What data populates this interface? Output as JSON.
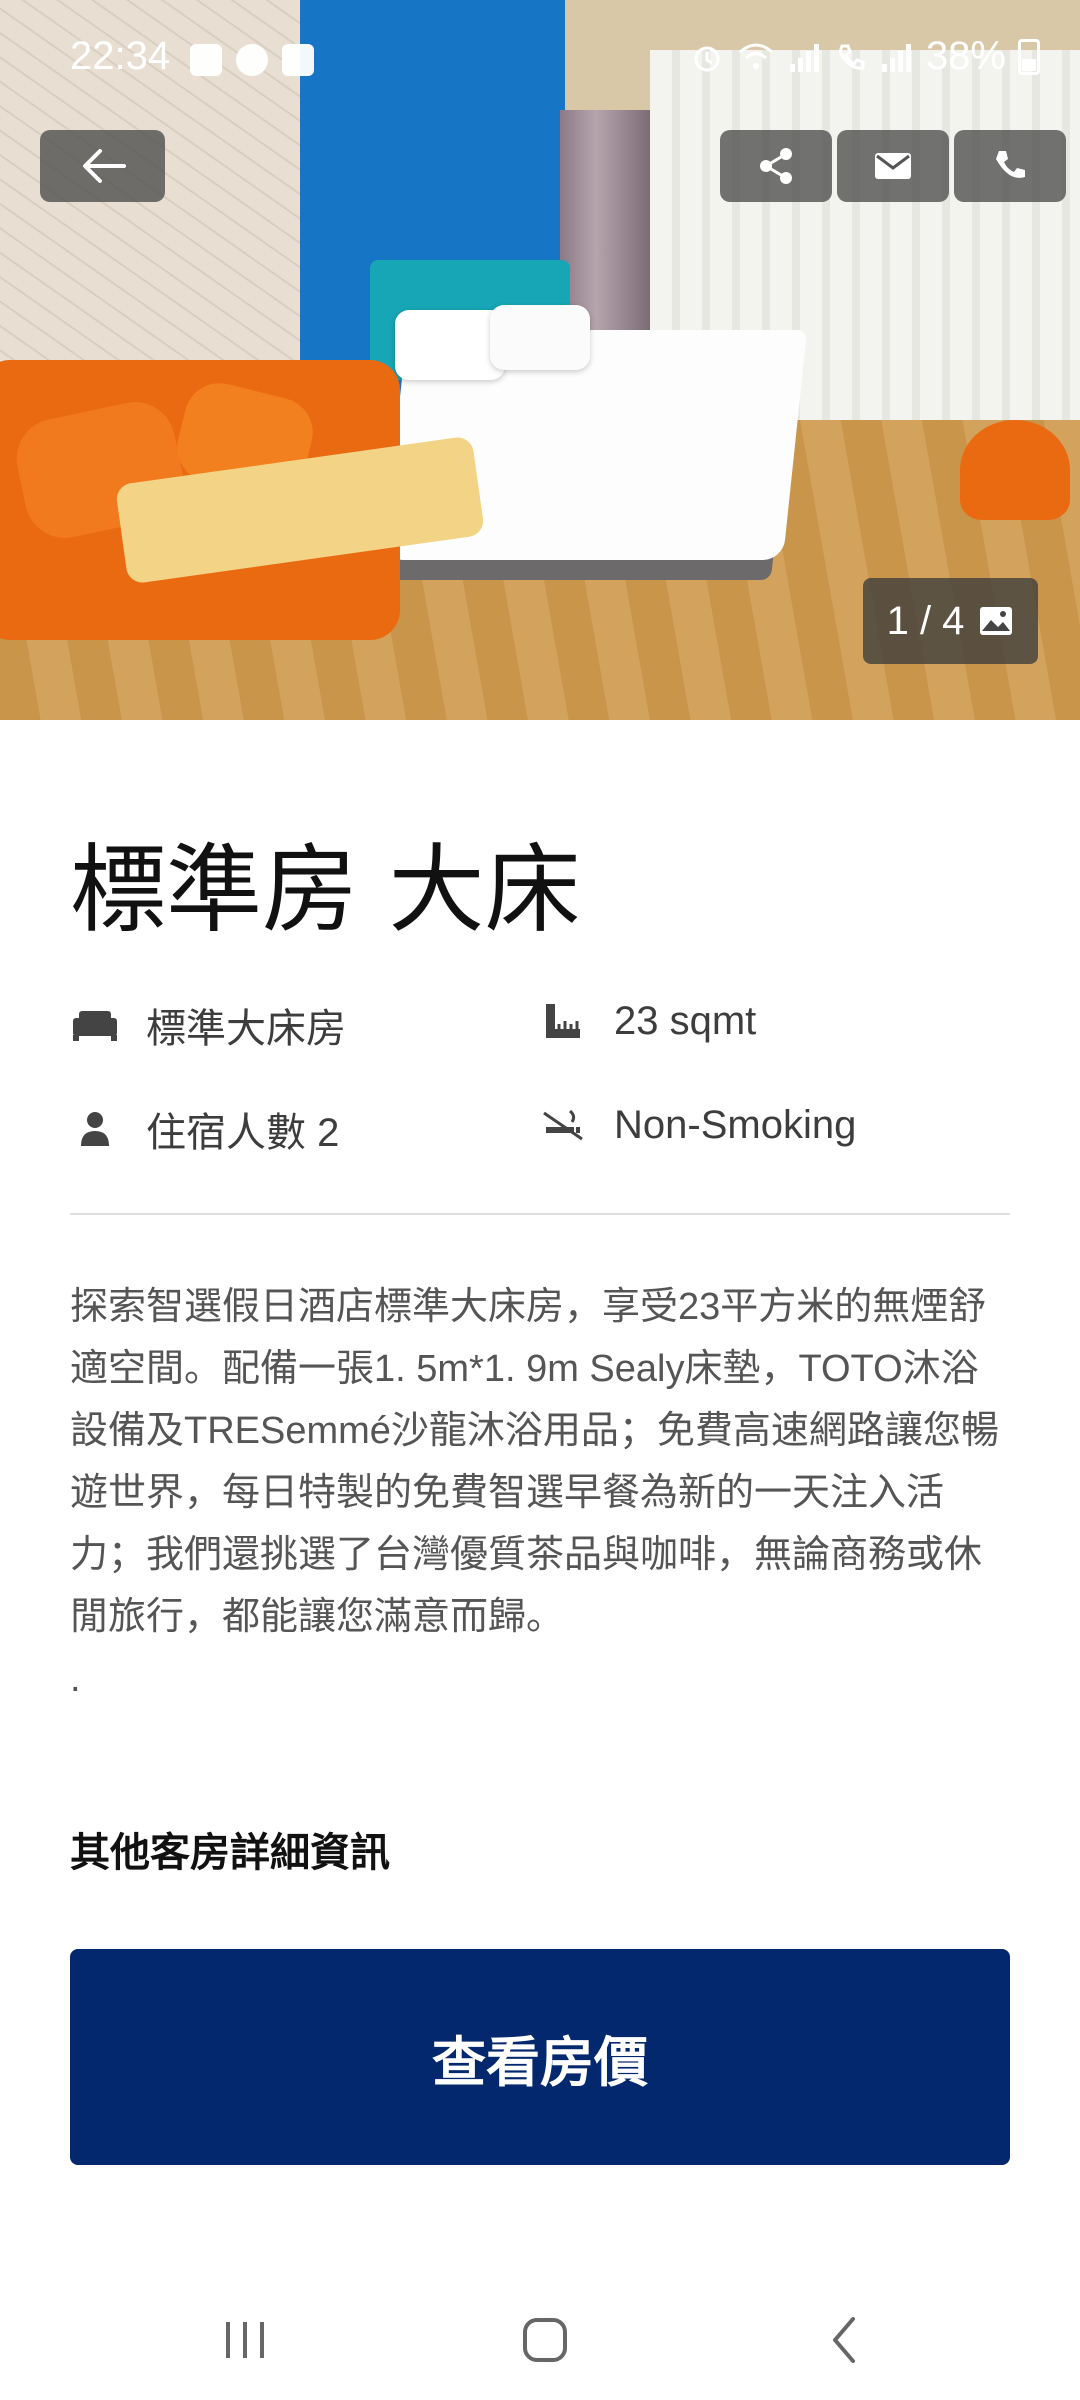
{
  "status_bar": {
    "time": "22:34",
    "battery": "38%"
  },
  "gallery": {
    "counter": "1 / 4"
  },
  "room": {
    "title": "標準房 大床",
    "features": [
      {
        "icon": "bed-icon",
        "label": "標準大床房"
      },
      {
        "icon": "area-ruler-icon",
        "label": "23 sqmt"
      },
      {
        "icon": "person-icon",
        "label": "住宿人數 2"
      },
      {
        "icon": "no-smoking-icon",
        "label": "Non-Smoking"
      }
    ],
    "description": "探索智選假日酒店標準大床房，享受23平方米的無煙舒適空間。配備一張1. 5m*1. 9m Sealy床墊，TOTO沐浴設備及TRESemmé沙龍沐浴用品；免費高速網路讓您暢遊世界，每日特製的免費智選早餐為新的一天注入活力；我們還挑選了台灣優質茶品與咖啡，無論商務或休閒旅行，都能讓您滿意而歸。",
    "description_trailer": ".",
    "more_details": "其他客房詳細資訊"
  },
  "cta": {
    "label": "查看房價"
  },
  "colors": {
    "cta_background": "#03286e",
    "overlay_button": "rgba(70,70,70,.75)"
  }
}
